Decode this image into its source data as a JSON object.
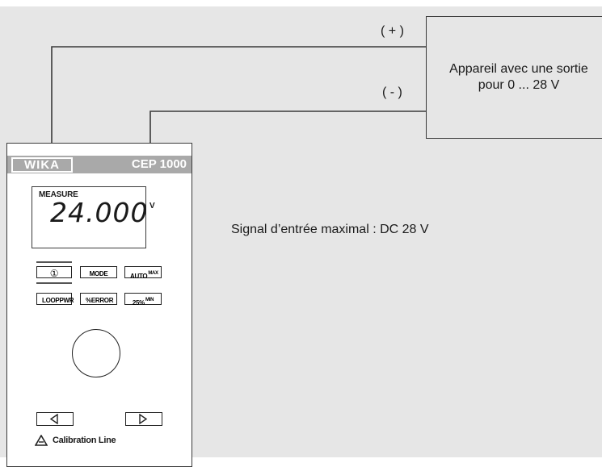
{
  "polarity": {
    "positive": "( + )",
    "negative": "( - )"
  },
  "device": {
    "line1": "Appareil avec une sortie",
    "line2": "pour 0 ... 28 V"
  },
  "signal_note": "Signal d’entrée maximal : DC 28 V",
  "calibrator": {
    "brand": "WIKA",
    "model": "CEP 1000",
    "display": {
      "mode": "MEASURE",
      "value": "24.000",
      "unit": "V"
    },
    "buttons": {
      "power": "①",
      "mode": "MODE",
      "auto": "AUTO",
      "auto_sup": "MAX",
      "looppwr": "LOOPPWR",
      "error": "%ERROR",
      "pct25": "25%",
      "pct25_sup": "MIN"
    },
    "footer": "Calibration Line"
  }
}
